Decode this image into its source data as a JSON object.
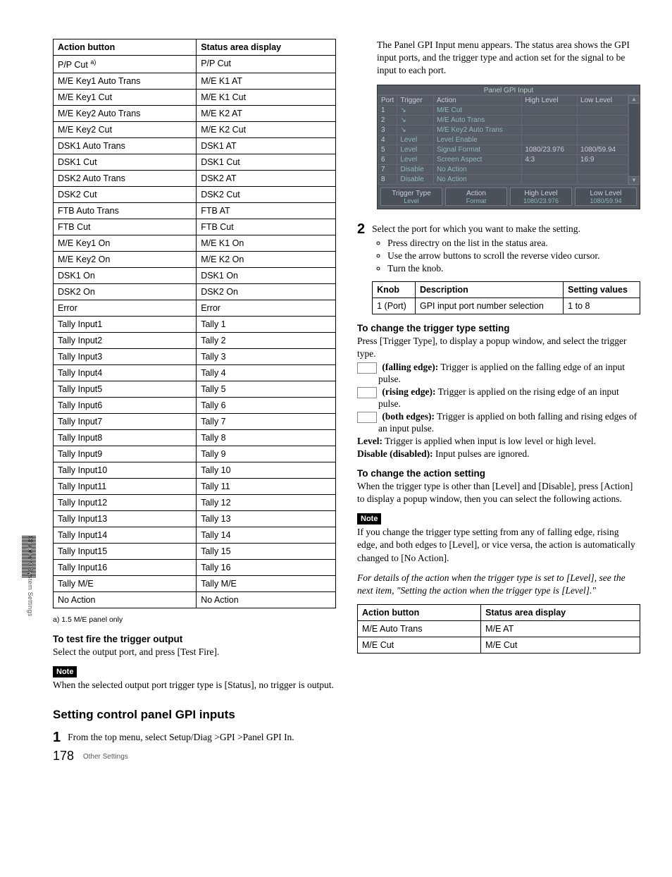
{
  "sidebar": {
    "chapter_label": "Chapter 9  System Settings"
  },
  "left_table": {
    "headers": [
      "Action button",
      "Status area display"
    ],
    "rows": [
      [
        "P/P Cut a)",
        "P/P Cut"
      ],
      [
        "M/E Key1 Auto Trans",
        "M/E K1 AT"
      ],
      [
        "M/E Key1 Cut",
        "M/E K1 Cut"
      ],
      [
        "M/E Key2 Auto Trans",
        "M/E K2 AT"
      ],
      [
        "M/E Key2 Cut",
        "M/E K2 Cut"
      ],
      [
        "DSK1 Auto Trans",
        "DSK1 AT"
      ],
      [
        "DSK1 Cut",
        "DSK1 Cut"
      ],
      [
        "DSK2 Auto Trans",
        "DSK2 AT"
      ],
      [
        "DSK2 Cut",
        "DSK2 Cut"
      ],
      [
        "FTB Auto Trans",
        "FTB AT"
      ],
      [
        "FTB Cut",
        "FTB Cut"
      ],
      [
        "M/E Key1 On",
        "M/E K1 On"
      ],
      [
        "M/E Key2 On",
        "M/E K2 On"
      ],
      [
        "DSK1 On",
        "DSK1 On"
      ],
      [
        "DSK2 On",
        "DSK2 On"
      ],
      [
        "Error",
        "Error"
      ],
      [
        "Tally Input1",
        "Tally 1"
      ],
      [
        "Tally Input2",
        "Tally 2"
      ],
      [
        "Tally Input3",
        "Tally 3"
      ],
      [
        "Tally Input4",
        "Tally 4"
      ],
      [
        "Tally Input5",
        "Tally 5"
      ],
      [
        "Tally Input6",
        "Tally 6"
      ],
      [
        "Tally Input7",
        "Tally 7"
      ],
      [
        "Tally Input8",
        "Tally 8"
      ],
      [
        "Tally Input9",
        "Tally 9"
      ],
      [
        "Tally Input10",
        "Tally 10"
      ],
      [
        "Tally Input11",
        "Tally 11"
      ],
      [
        "Tally Input12",
        "Tally 12"
      ],
      [
        "Tally Input13",
        "Tally 13"
      ],
      [
        "Tally Input14",
        "Tally 14"
      ],
      [
        "Tally Input15",
        "Tally 15"
      ],
      [
        "Tally Input16",
        "Tally 16"
      ],
      [
        "Tally M/E",
        "Tally M/E"
      ],
      [
        "No Action",
        "No Action"
      ]
    ],
    "footnote": "a) 1.5 M/E panel only"
  },
  "left": {
    "test_fire_h": "To test fire the trigger output",
    "test_fire_p": "Select the output port, and press [Test Fire].",
    "note_label": "Note",
    "note_p": "When the selected output port trigger type is [Status], no trigger is output.",
    "section_h": "Setting control panel GPI inputs",
    "step1_num": "1",
    "step1_text": "From the top menu, select Setup/Diag >GPI >Panel GPI In."
  },
  "right": {
    "intro_p": "The Panel GPI Input menu appears. The status area shows the GPI input ports, and the trigger type and action set for the signal to be input to each port.",
    "panel": {
      "title": "Panel GPI Input",
      "headers": [
        "Port",
        "Trigger",
        "Action",
        "High Level",
        "Low Level"
      ],
      "rows": [
        [
          "1",
          "↘",
          "M/E Cut",
          "",
          ""
        ],
        [
          "2",
          "↘",
          "M/E Auto Trans",
          "",
          ""
        ],
        [
          "3",
          "↘",
          "M/E Key2 Auto Trans",
          "",
          ""
        ],
        [
          "4",
          "Level",
          "Level Enable",
          "",
          ""
        ],
        [
          "5",
          "Level",
          "Signal Format",
          "1080/23.976",
          "1080/59.94"
        ],
        [
          "6",
          "Level",
          "Screen Aspect",
          "4:3",
          "16:9"
        ],
        [
          "7",
          "Disable",
          "No Action",
          "",
          ""
        ],
        [
          "8",
          "Disable",
          "No Action",
          "",
          ""
        ]
      ],
      "buttons": [
        {
          "top": "Trigger Type",
          "sub": "Level"
        },
        {
          "top": "Action",
          "sub": "Format"
        },
        {
          "top": "High Level",
          "sub": "1080/23.976"
        },
        {
          "top": "Low Level",
          "sub": "1080/59.94"
        }
      ]
    },
    "step2_num": "2",
    "step2_text": "Select the port for which you want to make the setting.",
    "bullets": [
      "Press directry on the list in the status area.",
      "Use the arrow buttons to scroll the reverse video cursor.",
      "Turn the knob."
    ],
    "knob_table": {
      "headers": [
        "Knob",
        "Description",
        "Setting values"
      ],
      "rows": [
        [
          "1 (Port)",
          "GPI input port number selection",
          "1 to 8"
        ]
      ]
    },
    "trigger_h": "To change the trigger type setting",
    "trigger_p": "Press [Trigger Type], to display a popup window, and select the trigger type.",
    "trigger_items": [
      {
        "label": " (falling edge):",
        "text": " Trigger is applied on the falling edge of an input pulse.",
        "icon": true
      },
      {
        "label": " (rising edge):",
        "text": " Trigger is applied on the rising edge of an input pulse.",
        "icon": true
      },
      {
        "label": " (both edges):",
        "text": " Trigger is applied on both falling and rising edges of an input pulse.",
        "icon": true
      },
      {
        "label": "Level:",
        "text": " Trigger is applied when input is low level or high level.",
        "icon": false
      },
      {
        "label": "Disable (disabled):",
        "text": " Input pulses are ignored.",
        "icon": false
      }
    ],
    "action_h": "To change the action setting",
    "action_p": "When the trigger type is other than [Level] and [Disable], press [Action] to display a popup window, then you can select the following actions.",
    "note_label": "Note",
    "note_p": "If you change the trigger type setting from any of falling edge, rising edge, and both edges to [Level], or vice versa, the action is automatically changed to [No Action].",
    "italic_p": "For details of the action when the trigger type is set to [Level], see the next item, \"Setting the action when the trigger type is [Level].\"",
    "action_table": {
      "headers": [
        "Action button",
        "Status area display"
      ],
      "rows": [
        [
          "M/E Auto Trans",
          "M/E AT"
        ],
        [
          "M/E Cut",
          "M/E Cut"
        ]
      ]
    }
  },
  "footer": {
    "page_num": "178",
    "section": "Other Settings"
  }
}
